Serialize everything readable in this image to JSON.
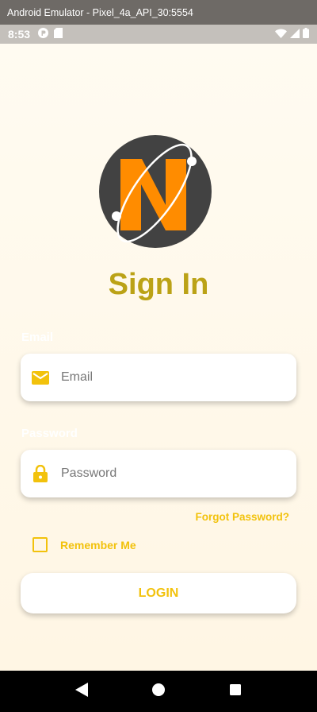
{
  "window": {
    "title": "Android Emulator - Pixel_4a_API_30:5554"
  },
  "status_bar": {
    "time": "8:53",
    "left_icons": [
      "notification-p-icon",
      "sd-card-icon"
    ],
    "right_icons": [
      "wifi-icon",
      "cell-signal-icon",
      "battery-icon"
    ]
  },
  "screen": {
    "title": "Sign In",
    "email": {
      "label": "Email",
      "placeholder": "Email",
      "icon": "mail-icon"
    },
    "password": {
      "label": "Password",
      "placeholder": "Password",
      "icon": "lock-icon"
    },
    "forgot_password": "Forgot Password?",
    "remember_me": {
      "label": "Remember Me",
      "checked": false
    },
    "login_button": "LOGIN"
  },
  "nav_bar": {
    "buttons": [
      "back-icon",
      "home-icon",
      "recents-icon"
    ]
  },
  "colors": {
    "accent": "#f2c20c",
    "title": "#bba216",
    "logo_bg": "#424242",
    "logo_letter": "#ff8c00"
  }
}
